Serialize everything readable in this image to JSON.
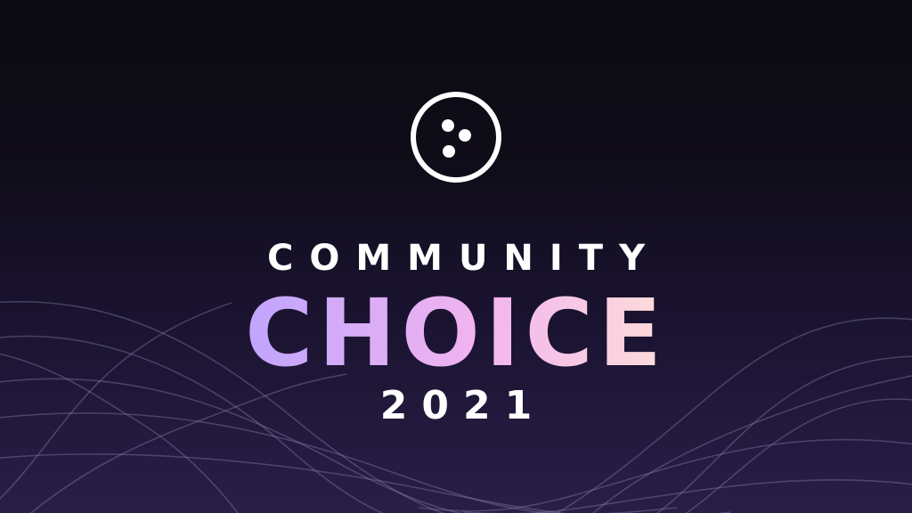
{
  "banner": {
    "line1": "COMMUNITY",
    "line2": "CHOICE",
    "line3": "2021",
    "colors": {
      "background_top": "#0b0a10",
      "background_bottom": "#2a1e47",
      "gradient_start": "#b9a2ff",
      "gradient_mid": "#f2b4ef",
      "gradient_end": "#ffe3d6",
      "text": "#ffffff"
    },
    "logo_icon": "three-dot-circle-icon"
  }
}
